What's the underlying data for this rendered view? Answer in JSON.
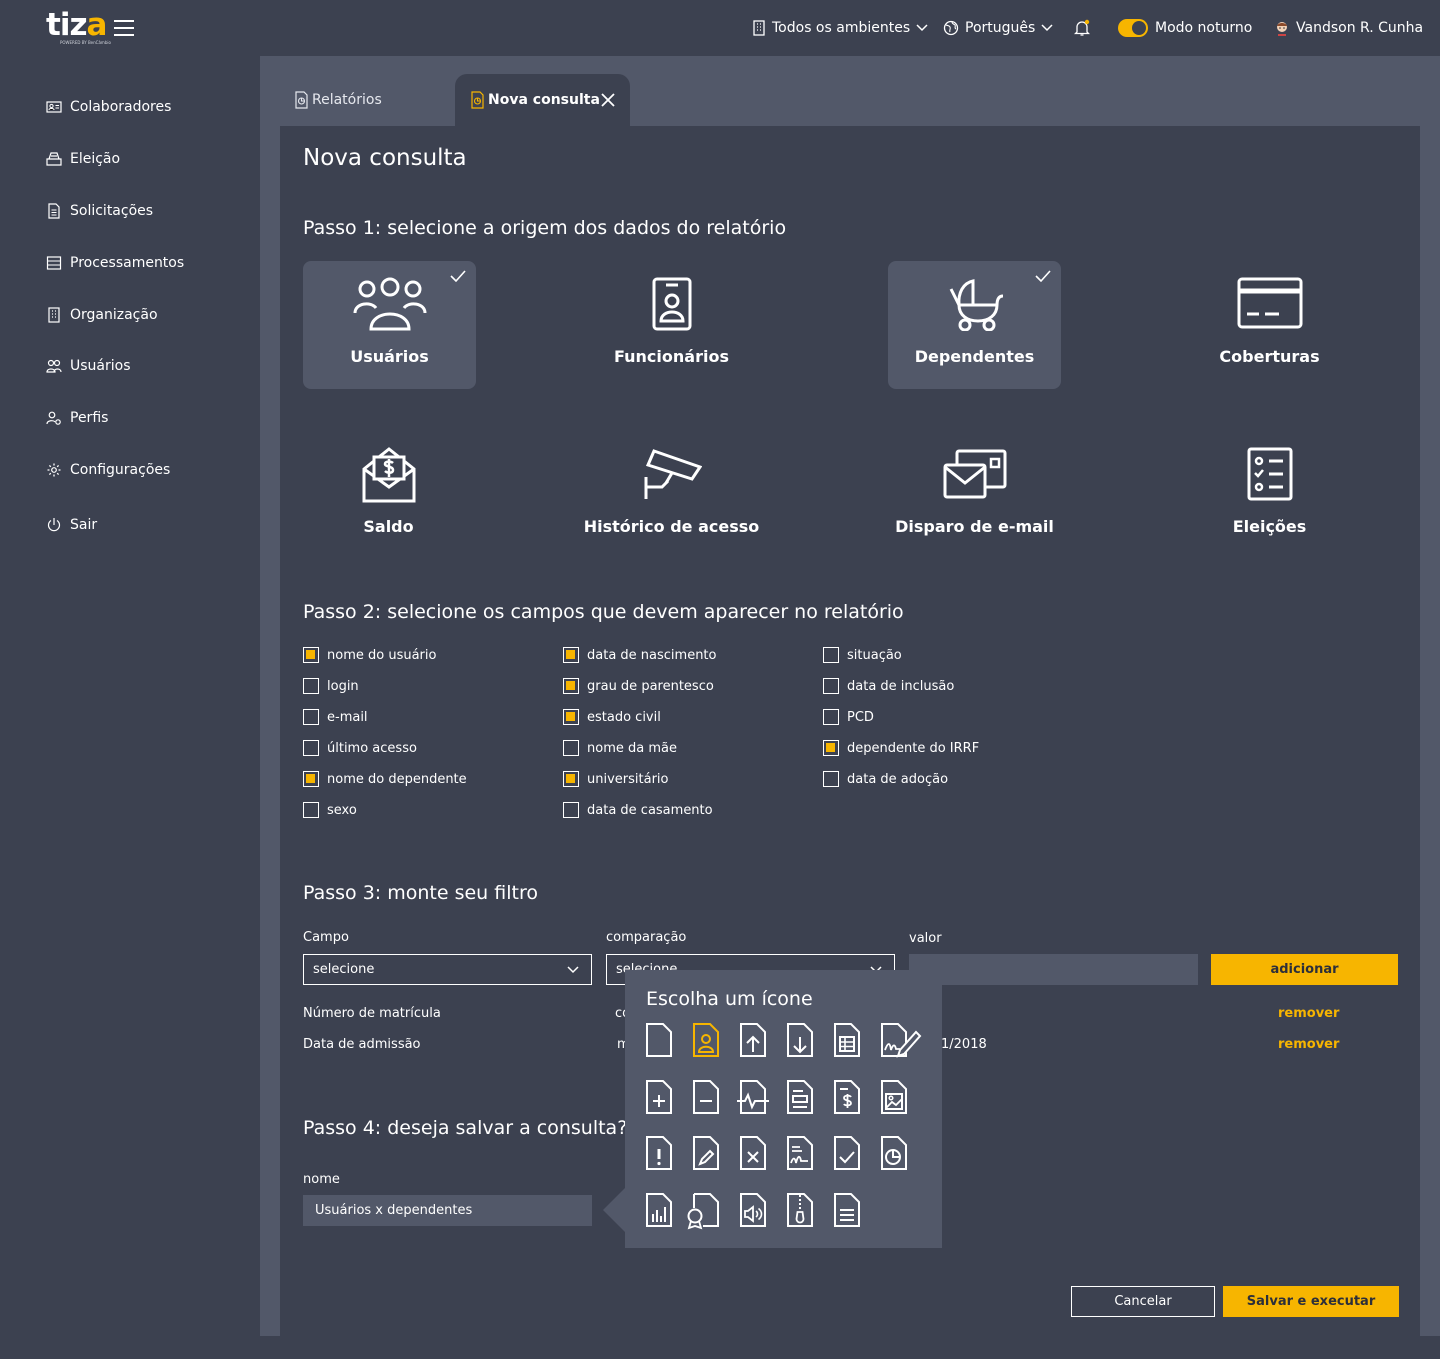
{
  "app": {
    "logo": "tiza",
    "logo_subtitle": "POWERED BY BenCâmbio"
  },
  "topbar": {
    "environment": "Todos os ambientes",
    "language": "Português",
    "night_mode": "Modo noturno",
    "user": "Vandson R. Cunha"
  },
  "sidebar": {
    "items": [
      {
        "label": "Colaboradores",
        "icon": "id-card-icon"
      },
      {
        "label": "Eleição",
        "icon": "ballot-box-icon"
      },
      {
        "label": "Solicitações",
        "icon": "document-icon"
      },
      {
        "label": "Processamentos",
        "icon": "list-icon"
      },
      {
        "label": "Organização",
        "icon": "building-icon"
      },
      {
        "label": "Usuários",
        "icon": "users-icon"
      },
      {
        "label": "Perfis",
        "icon": "user-gear-icon"
      },
      {
        "label": "Configurações",
        "icon": "gear-icon"
      },
      {
        "label": "Sair",
        "icon": "power-icon"
      }
    ]
  },
  "tabs": [
    {
      "label": "Relatórios",
      "active": false
    },
    {
      "label": "Nova consulta",
      "active": true
    }
  ],
  "page": {
    "title": "Nova consulta",
    "step1": "Passo 1: selecione a origem dos dados do relatório",
    "step2": "Passo 2: selecione os campos que devem aparecer no relatório",
    "step3": "Passo 3: monte seu filtro",
    "step4": "Passo 4: deseja salvar a consulta?"
  },
  "sources": [
    {
      "label": "Usuários",
      "icon": "users-group-icon",
      "selected": true
    },
    {
      "label": "Funcionários",
      "icon": "badge-icon",
      "selected": false
    },
    {
      "label": "Dependentes",
      "icon": "baby-carriage-icon",
      "selected": true
    },
    {
      "label": "Coberturas",
      "icon": "credit-card-icon",
      "selected": false
    },
    {
      "label": "Saldo",
      "icon": "money-envelope-icon",
      "selected": false
    },
    {
      "label": "Histórico de acesso",
      "icon": "security-camera-icon",
      "selected": false
    },
    {
      "label": "Disparo de e-mail",
      "icon": "mail-send-icon",
      "selected": false
    },
    {
      "label": "Eleições",
      "icon": "checklist-icon",
      "selected": false
    }
  ],
  "fields": [
    [
      {
        "label": "nome do usuário",
        "checked": true
      },
      {
        "label": "login",
        "checked": false
      },
      {
        "label": "e-mail",
        "checked": false
      },
      {
        "label": "último acesso",
        "checked": false
      },
      {
        "label": "nome do dependente",
        "checked": true
      },
      {
        "label": "sexo",
        "checked": false
      }
    ],
    [
      {
        "label": "data de nascimento",
        "checked": true
      },
      {
        "label": "grau de parentesco",
        "checked": true
      },
      {
        "label": "estado civil",
        "checked": true
      },
      {
        "label": "nome da mãe",
        "checked": false
      },
      {
        "label": "universitário",
        "checked": true
      },
      {
        "label": "data de casamento",
        "checked": false
      }
    ],
    [
      {
        "label": "situação",
        "checked": false
      },
      {
        "label": "data de inclusão",
        "checked": false
      },
      {
        "label": "PCD",
        "checked": false
      },
      {
        "label": "dependente do IRRF",
        "checked": true
      },
      {
        "label": "data de adoção",
        "checked": false
      }
    ]
  ],
  "filter": {
    "field_label": "Campo",
    "field_value": "selecione",
    "comparison_label": "comparação",
    "comparison_value": "selecione",
    "value_label": "valor",
    "value": "",
    "add_button": "adicionar",
    "rows": [
      {
        "field": "Número de matrícula",
        "comparison": "co",
        "value": "",
        "remove": "remover"
      },
      {
        "field": "Data de admissão",
        "comparison": "m",
        "value": "1/2018",
        "remove": "remover"
      }
    ]
  },
  "save": {
    "name_label": "nome",
    "name_value": "Usuários x dependentes",
    "cancel": "Cancelar",
    "save_execute": "Salvar e executar"
  },
  "icon_picker": {
    "title": "Escolha um ícone",
    "selected_index": 1,
    "icons": [
      "blank-file-icon",
      "user-file-icon",
      "upload-file-icon",
      "download-file-icon",
      "spreadsheet-file-icon",
      "signature-file-icon",
      "add-file-icon",
      "remove-file-icon",
      "pulse-file-icon",
      "form-file-icon",
      "invoice-file-icon",
      "image-file-icon",
      "alert-file-icon",
      "edit-file-icon",
      "delete-file-icon",
      "chart-line-file-icon",
      "check-file-icon",
      "pie-file-icon",
      "bar-chart-file-icon",
      "certificate-file-icon",
      "audio-file-icon",
      "zip-file-icon",
      "text-file-icon"
    ]
  },
  "colors": {
    "background": "#3c4150",
    "surface": "#525869",
    "accent": "#f7b500",
    "text": "#ffffff"
  }
}
